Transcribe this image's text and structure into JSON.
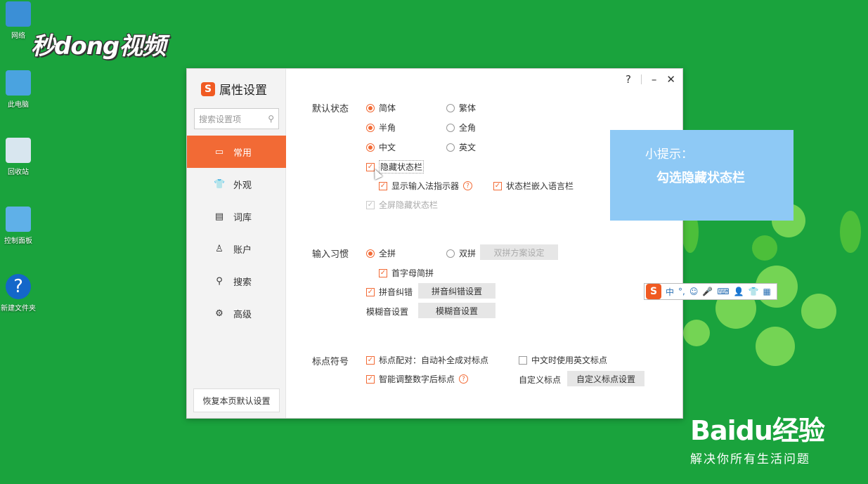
{
  "desktop": {
    "icons": [
      {
        "label": "网络"
      },
      {
        "label": "此电脑"
      },
      {
        "label": "回收站"
      },
      {
        "label": "控制面板"
      },
      {
        "label": "新建文件夹"
      }
    ],
    "watermark_top": "秒dong视频"
  },
  "dialog": {
    "title": "属性设置",
    "search_placeholder": "搜索设置项",
    "nav": [
      {
        "label": "常用",
        "icon": "monitor-icon"
      },
      {
        "label": "外观",
        "icon": "shirt-icon"
      },
      {
        "label": "词库",
        "icon": "book-icon"
      },
      {
        "label": "账户",
        "icon": "user-icon"
      },
      {
        "label": "搜索",
        "icon": "search-icon"
      },
      {
        "label": "高级",
        "icon": "gear-icon"
      }
    ],
    "restore_button": "恢复本页默认设置",
    "controls": {
      "help": "?",
      "minimize": "–",
      "close": "✕"
    },
    "default_state": {
      "label": "默认状态",
      "simplified": "简体",
      "traditional": "繁体",
      "half_width": "半角",
      "full_width": "全角",
      "chinese": "中文",
      "english": "英文",
      "hide_status_bar": "隐藏状态栏",
      "show_indicator": "显示输入法指示器",
      "embed_lang_bar": "状态栏嵌入语言栏",
      "fullscreen_hide": "全屏隐藏状态栏"
    },
    "input_habit": {
      "label": "输入习惯",
      "full_pinyin": "全拼",
      "double_pinyin": "双拼",
      "double_scheme_button": "双拼方案设定",
      "initial_abbrev": "首字母简拼",
      "pinyin_correct": "拼音纠错",
      "pinyin_correct_button": "拼音纠错设置",
      "fuzzy_label": "模糊音设置",
      "fuzzy_button": "模糊音设置"
    },
    "punctuation": {
      "label": "标点符号",
      "auto_pair": "标点配对：自动补全成对标点",
      "english_punct": "中文时使用英文标点",
      "smart_adjust": "智能调整数字后标点",
      "custom_label": "自定义标点",
      "custom_button": "自定义标点设置"
    }
  },
  "tip": {
    "line1": "小提示：",
    "line2": "勾选隐藏状态栏"
  },
  "sogou_bar": {
    "mode": "中"
  },
  "baidu": {
    "logo": "Baidu经验",
    "slogan": "解决你所有生活问题"
  }
}
